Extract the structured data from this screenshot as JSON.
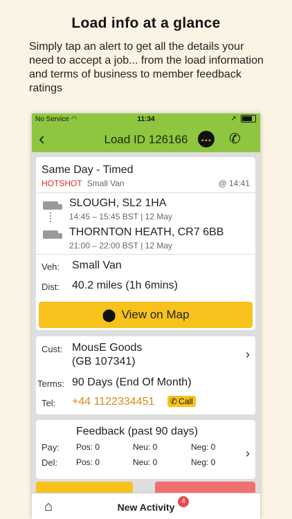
{
  "promo": {
    "title": "Load info at a glance",
    "body": "Simply tap an alert to get all the details your need to accept a job... from the load information and terms of business to member feedback ratings"
  },
  "status_bar": {
    "carrier": "No Service",
    "time": "11:34"
  },
  "nav": {
    "back_icon": "chevron-left",
    "title": "Load ID 126166",
    "chat_icon": "chat-bubble",
    "phone_icon": "phone"
  },
  "load": {
    "type": "Same Day - Timed",
    "tag": "HOTSHOT",
    "vehicle_small": "Small Van",
    "posted_time": "@ 14:41",
    "pickup": {
      "place": "SLOUGH, SL2 1HA",
      "window": "14:45 – 15:45 BST | 12 May"
    },
    "dropoff": {
      "place": "THORNTON HEATH, CR7 6BB",
      "window": "21:00 – 22:00 BST | 12 May"
    },
    "veh_label": "Veh:",
    "veh_value": "Small Van",
    "dist_label": "Dist:",
    "dist_value": "40.2 miles (1h 6mins)",
    "map_button": "View on Map"
  },
  "customer": {
    "cust_label": "Cust:",
    "name": "MousE Goods",
    "code": "(GB 107341)",
    "terms_label": "Terms:",
    "terms_value": "90 Days (End Of Month)",
    "tel_label": "Tel:",
    "tel_value": "+44 1122334451",
    "call_label": "Call"
  },
  "feedback": {
    "title": "Feedback (past 90 days)",
    "rows": [
      {
        "label": "Pay:",
        "pos": "Pos: 0",
        "neu": "Neu: 0",
        "neg": "Neg: 0"
      },
      {
        "label": "Del:",
        "pos": "Pos: 0",
        "neu": "Neu: 0",
        "neg": "Neg: 0"
      }
    ]
  },
  "tabbar": {
    "new_activity": "New Activity",
    "badge": "4"
  },
  "colors": {
    "accent_green": "#8ec63f",
    "accent_yellow": "#f6c21b",
    "hotshot_red": "#e0282c",
    "tel_orange": "#d98a16"
  }
}
